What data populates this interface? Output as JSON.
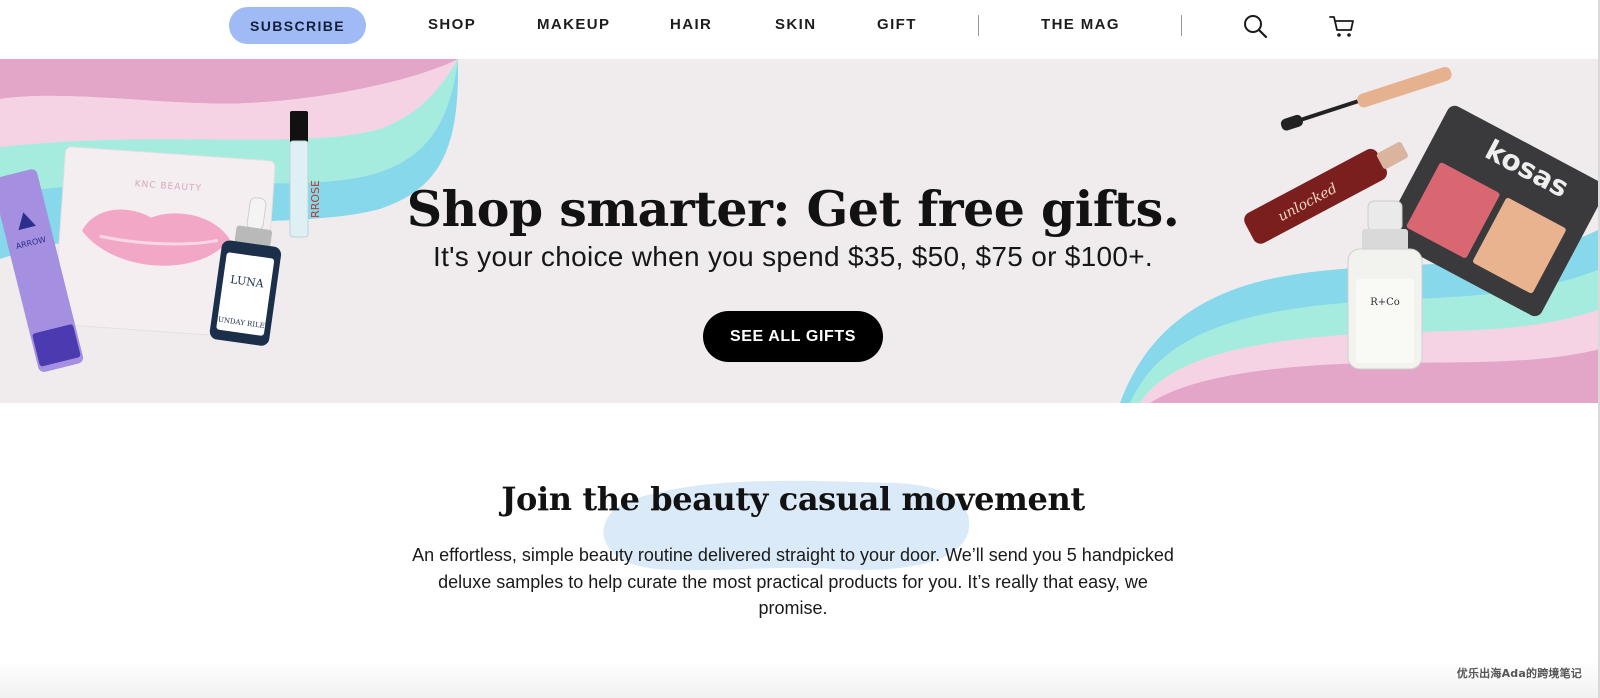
{
  "nav": {
    "subscribe_label": "SUBSCRIBE",
    "links": [
      "SHOP",
      "MAKEUP",
      "HAIR",
      "SKIN",
      "GIFT"
    ],
    "mag_label": "THE MAG",
    "search_icon": "search-icon",
    "cart_icon": "cart-icon"
  },
  "hero": {
    "title": "Shop smarter: Get free gifts.",
    "subtitle": "It's your choice when you spend $35, $50, $75 or $100+.",
    "cta_label": "SEE ALL GIFTS",
    "products_left": {
      "lip_mask_brand": "KNC BEAUTY",
      "tube_brand": "ARROW",
      "serum_name": "LUNA",
      "serum_brand": "SUNDAY RILEY",
      "vial_label": "RROSE"
    },
    "products_right": {
      "palette_brand": "kosas",
      "mascara_label": "unlocked",
      "spray_brand": "R+Co"
    },
    "colors": {
      "band_bg": "#f0ecee",
      "pink": "#e3a6c8",
      "teal": "#a5ecdf",
      "blue": "#86d8ea"
    }
  },
  "movement": {
    "title": "Join the beauty casual movement",
    "text": "An effortless, simple beauty routine delivered straight to your door. We’ll send you 5 handpicked deluxe samples to help curate the most practical products for you. It’s really that easy, we promise."
  },
  "watermark": "优乐出海Ada的跨境笔记",
  "colors": {
    "subscribe_bg": "#9fbaf5",
    "cta_bg": "#000000",
    "brush": "#d6e8f8"
  }
}
